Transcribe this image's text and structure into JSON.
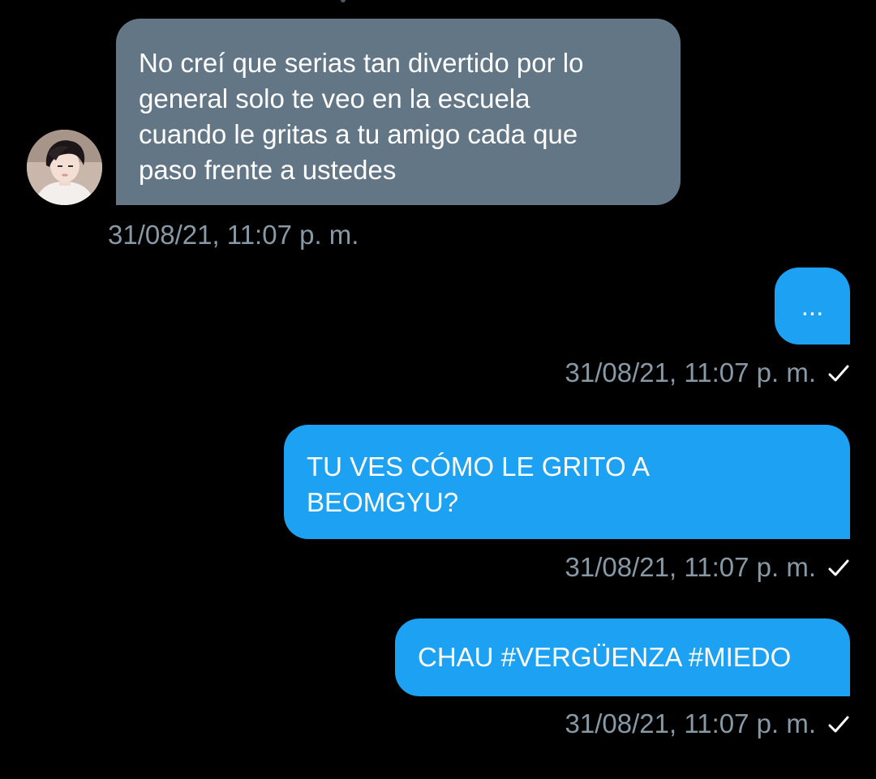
{
  "conversation": {
    "messages": [
      {
        "direction": "received",
        "text": "No creí que serias tan divertido por lo\ngeneral solo te veo en la escuela\ncuando le gritas a tu amigo cada que\npaso frente a ustedes",
        "timestamp": "31/08/21, 11:07 p. m."
      },
      {
        "direction": "sent",
        "text": "...",
        "timestamp": "31/08/21, 11:07 p. m.",
        "status_icon": "check-icon"
      },
      {
        "direction": "sent",
        "text": "TU VES CÓMO LE GRITO A\nBEOMGYU?",
        "timestamp": "31/08/21, 11:07 p. m.",
        "status_icon": "check-icon"
      },
      {
        "direction": "sent",
        "text": "CHAU #VERGÜENZA #MIEDO",
        "timestamp": "31/08/21, 11:07 p. m.",
        "status_icon": "check-icon"
      }
    ],
    "sender_avatar_icon": "avatar-photo"
  },
  "colors": {
    "background": "#000000",
    "received_bubble": "#637686",
    "sent_bubble": "#1da1f2",
    "timestamp_text": "#8899a6",
    "message_text": "#ffffff"
  }
}
